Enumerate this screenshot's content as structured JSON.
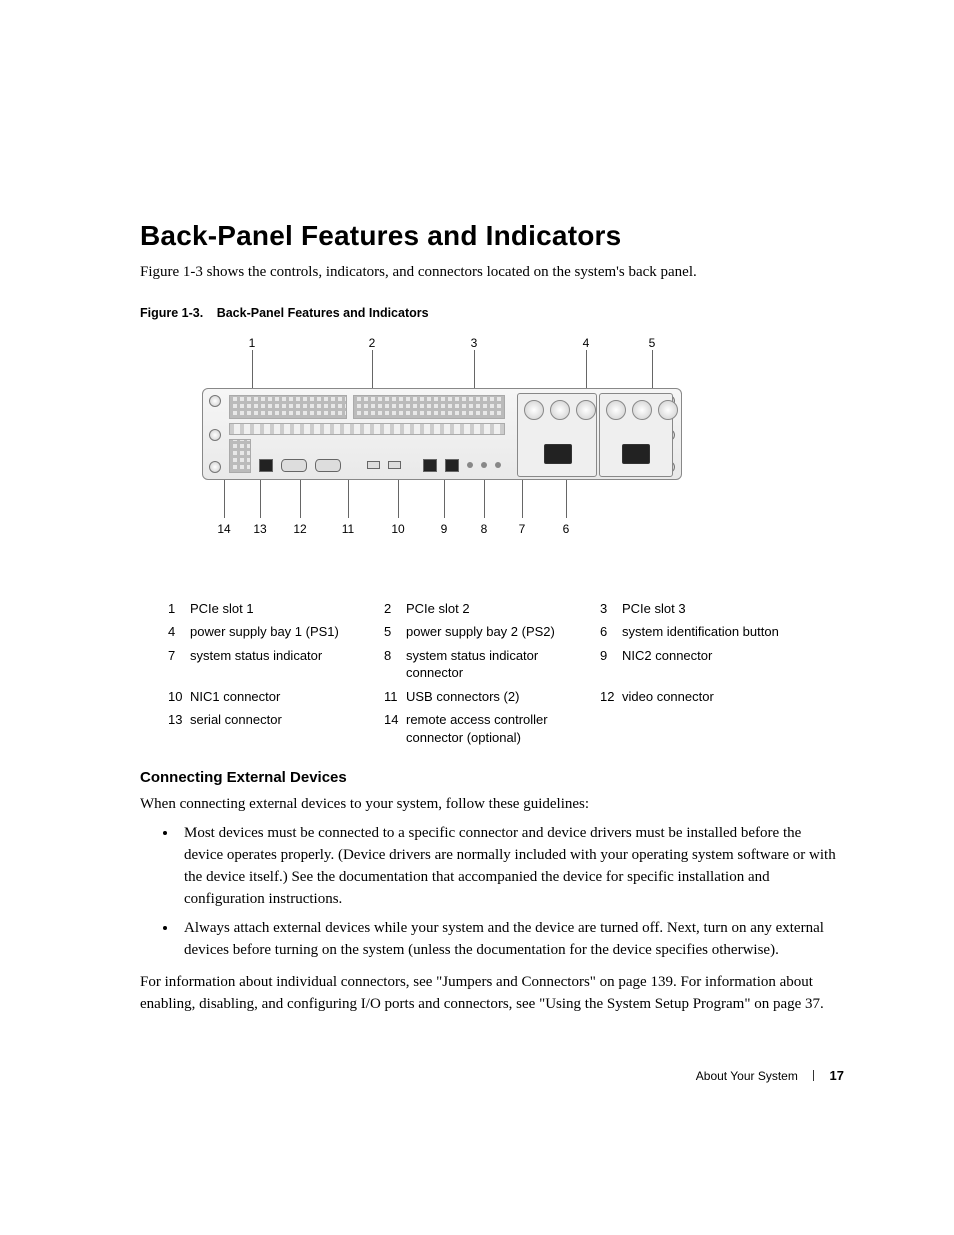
{
  "heading": "Back-Panel Features and Indicators",
  "intro": "Figure 1-3 shows the controls, indicators, and connectors located on the system's back panel.",
  "figure": {
    "label": "Figure 1-3.",
    "title": "Back-Panel Features and Indicators",
    "top_callouts": [
      "1",
      "2",
      "3",
      "4",
      "5"
    ],
    "bottom_callouts": [
      "14",
      "13",
      "12",
      "11",
      "10",
      "9",
      "8",
      "7",
      "6"
    ]
  },
  "legend": [
    {
      "n": "1",
      "t": "PCIe slot 1"
    },
    {
      "n": "2",
      "t": "PCIe slot 2"
    },
    {
      "n": "3",
      "t": "PCIe slot 3"
    },
    {
      "n": "4",
      "t": "power supply bay 1 (PS1)"
    },
    {
      "n": "5",
      "t": "power supply bay 2 (PS2)"
    },
    {
      "n": "6",
      "t": "system identification button"
    },
    {
      "n": "7",
      "t": "system status indicator"
    },
    {
      "n": "8",
      "t": "system status indicator connector"
    },
    {
      "n": "9",
      "t": "NIC2 connector"
    },
    {
      "n": "10",
      "t": "NIC1 connector"
    },
    {
      "n": "11",
      "t": "USB connectors (2)"
    },
    {
      "n": "12",
      "t": "video connector"
    },
    {
      "n": "13",
      "t": "serial connector"
    },
    {
      "n": "14",
      "t": "remote access controller connector (optional)"
    }
  ],
  "sub_heading": "Connecting External Devices",
  "sub_intro": "When connecting external devices to your system, follow these guidelines:",
  "bullets": [
    "Most devices must be connected to a specific connector and device drivers must be installed before the device operates properly. (Device drivers are normally included with your operating system software or with the device itself.) See the documentation that accompanied the device for specific installation and configuration instructions.",
    "Always attach external devices while your system and the device are turned off. Next, turn on any external devices before turning on the system (unless the documentation for the device specifies otherwise)."
  ],
  "closing": "For information about individual connectors, see \"Jumpers and Connectors\" on page 139. For information about enabling, disabling, and configuring I/O ports and connectors, see \"Using the System Setup Program\" on page 37.",
  "footer_section": "About Your System",
  "footer_page": "17"
}
